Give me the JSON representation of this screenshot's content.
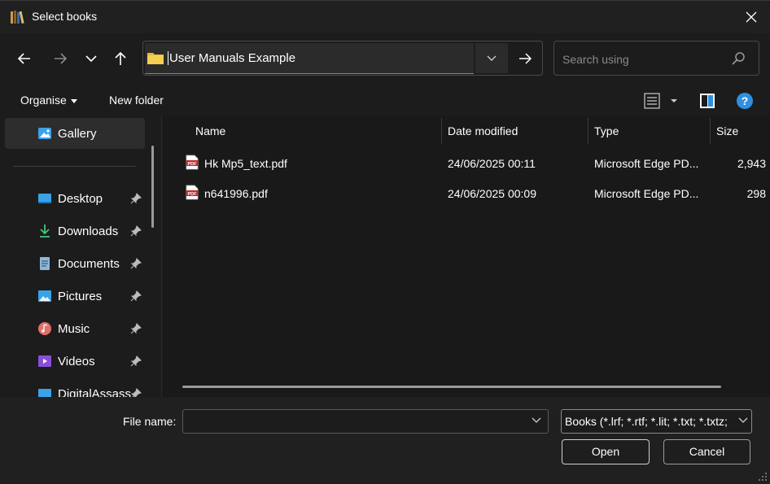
{
  "window": {
    "title": "Select books"
  },
  "address": {
    "path": "User Manuals Example"
  },
  "search": {
    "placeholder": "Search using"
  },
  "commands": {
    "organise": "Organise",
    "new_folder": "New folder",
    "help": "?"
  },
  "sidebar": {
    "items": [
      {
        "label": "Gallery",
        "icon": "gallery-icon"
      },
      {
        "label": "Desktop",
        "icon": "desktop-icon"
      },
      {
        "label": "Downloads",
        "icon": "downloads-icon"
      },
      {
        "label": "Documents",
        "icon": "documents-icon"
      },
      {
        "label": "Pictures",
        "icon": "pictures-icon"
      },
      {
        "label": "Music",
        "icon": "music-icon"
      },
      {
        "label": "Videos",
        "icon": "videos-icon"
      },
      {
        "label": "DigitalAssass",
        "icon": "folder-icon"
      }
    ]
  },
  "columns": {
    "name": "Name",
    "date": "Date modified",
    "type": "Type",
    "size": "Size"
  },
  "files": [
    {
      "name": "Hk Mp5_text.pdf",
      "date": "24/06/2025 00:11",
      "type": "Microsoft Edge PD...",
      "size": "2,943"
    },
    {
      "name": "n641996.pdf",
      "date": "24/06/2025 00:09",
      "type": "Microsoft Edge PD...",
      "size": "298"
    }
  ],
  "footer": {
    "file_name_label": "File name:",
    "file_name_value": "",
    "file_type": "Books (*.lrf; *.rtf; *.lit; *.txt; *.txtz;",
    "open": "Open",
    "cancel": "Cancel"
  },
  "colors": {
    "accent": "#2f8fe0",
    "background": "#202020",
    "pdf_red": "#c4262e"
  }
}
